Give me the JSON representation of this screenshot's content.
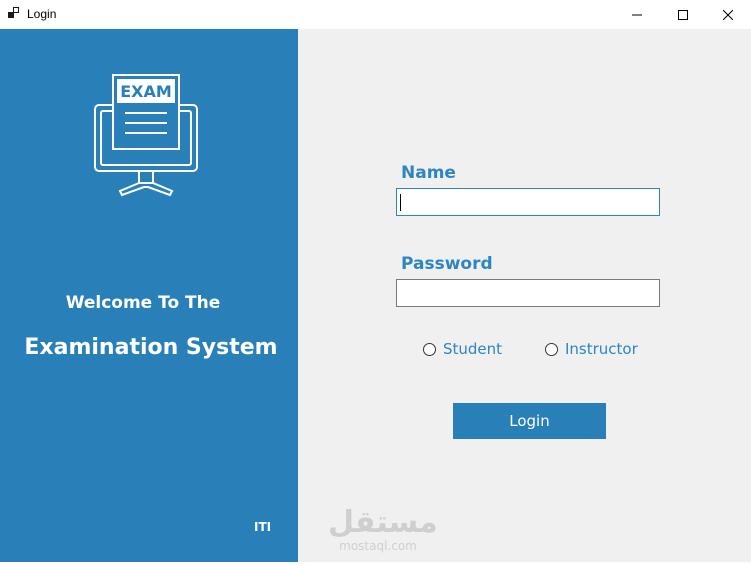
{
  "window": {
    "title": "Login",
    "controls": {
      "minimize": "minimize",
      "maximize": "maximize",
      "close": "close"
    }
  },
  "left_panel": {
    "logo_text": "EXAM",
    "welcome_line1": "Welcome To The",
    "welcome_line2": "Examination System",
    "org": "ITI",
    "background_color": "#2980b9"
  },
  "form": {
    "name_label": "Name",
    "name_value": "",
    "password_label": "Password",
    "password_value": "",
    "role_options": [
      {
        "label": "Student",
        "selected": false
      },
      {
        "label": "Instructor",
        "selected": false
      }
    ],
    "login_button": "Login",
    "accent_color": "#2e86c1"
  },
  "watermark": {
    "arabic": "مستقل",
    "latin": "mostaql.com"
  }
}
